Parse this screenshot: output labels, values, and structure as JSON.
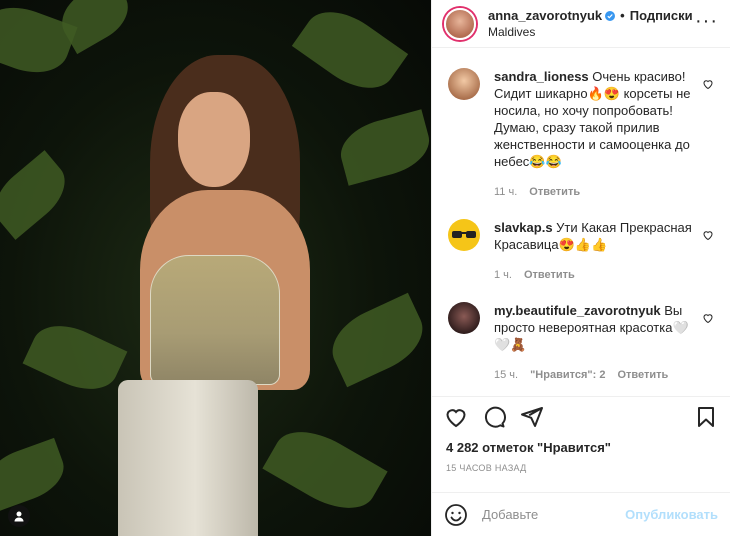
{
  "post": {
    "username": "anna_zavorotnyuk",
    "follow_label": "Подписки",
    "location": "Maldives",
    "likes": "4 282 отметок \"Нравится\"",
    "time": "15 часов назад",
    "add_comment_placeholder": "Добавьте",
    "publish_label": "Опубликовать"
  },
  "comments": [
    {
      "user": "sandra_lioness",
      "text": "Очень красиво! Сидит шикарно🔥😍 корсеты не носила, но хочу попробовать! Думаю, сразу такой прилив женственности и самооценка до небес😂😂",
      "time": "11 ч.",
      "likes": "",
      "reply": "Ответить"
    },
    {
      "user": "slavkap.s",
      "text": "Ути Какая Прекрасная Красавица😍👍👍",
      "time": "1 ч.",
      "likes": "",
      "reply": "Ответить"
    },
    {
      "user": "my.beautifule_zavorotnyuk",
      "text": "Вы просто невероятная красотка🤍🤍🧸",
      "time": "15 ч.",
      "likes": "\"Нравится\": 2",
      "reply": "Ответить"
    }
  ],
  "colors": {
    "accent": "#0095f6",
    "publish_disabled": "#b2dffc",
    "muted": "#8e8e8e"
  }
}
